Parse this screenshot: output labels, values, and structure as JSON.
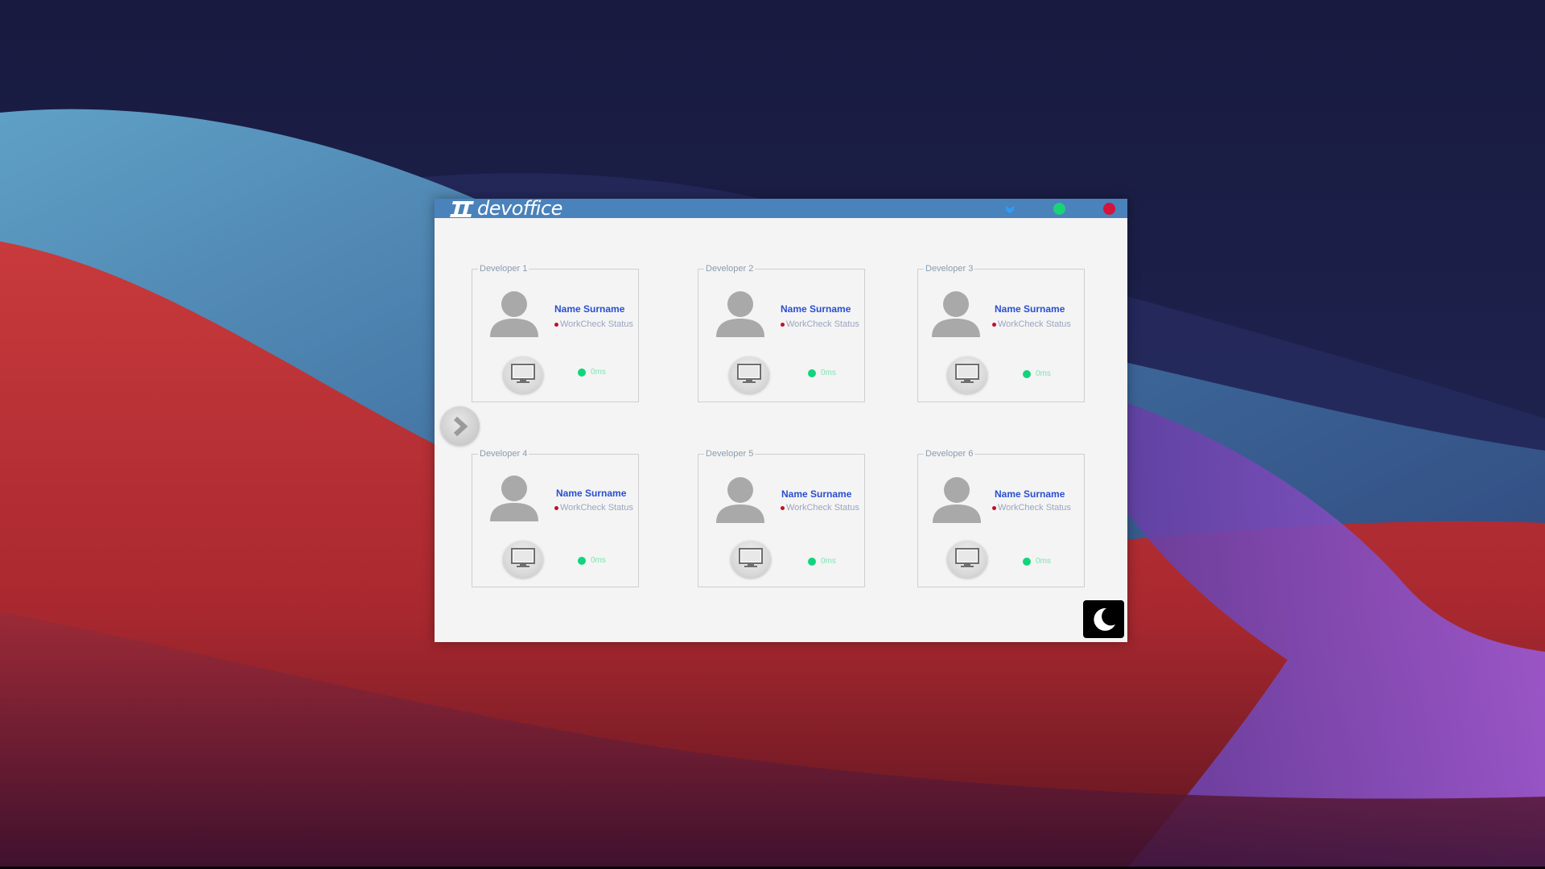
{
  "app": {
    "title": "devoffice"
  },
  "window_controls": {
    "minimize_icon": "chevron-down-icon",
    "maximize_color": "#19d377",
    "close_color": "#d4143a"
  },
  "colors": {
    "title_bar": "#4a82bb",
    "window_background": "#f4f4f4",
    "name_text": "#2a4fd0",
    "status_dot": "#c0102a",
    "ping_dot": "#12d47c"
  },
  "developers": [
    {
      "label": "Developer 1",
      "name": "Name Surname",
      "status": "WorkCheck Status",
      "ping": "0ms"
    },
    {
      "label": "Developer 2",
      "name": "Name Surname",
      "status": "WorkCheck Status",
      "ping": "0ms"
    },
    {
      "label": "Developer 3",
      "name": "Name Surname",
      "status": "WorkCheck Status",
      "ping": "0ms"
    },
    {
      "label": "Developer 4",
      "name": "Name Surname",
      "status": "WorkCheck Status",
      "ping": "0ms"
    },
    {
      "label": "Developer 5",
      "name": "Name Surname",
      "status": "WorkCheck Status",
      "ping": "0ms"
    },
    {
      "label": "Developer 6",
      "name": "Name Surname",
      "status": "WorkCheck Status",
      "ping": "0ms"
    }
  ],
  "navigation": {
    "next_icon": "chevron-right-icon"
  },
  "theme_toggle": {
    "icon": "moon-icon"
  }
}
